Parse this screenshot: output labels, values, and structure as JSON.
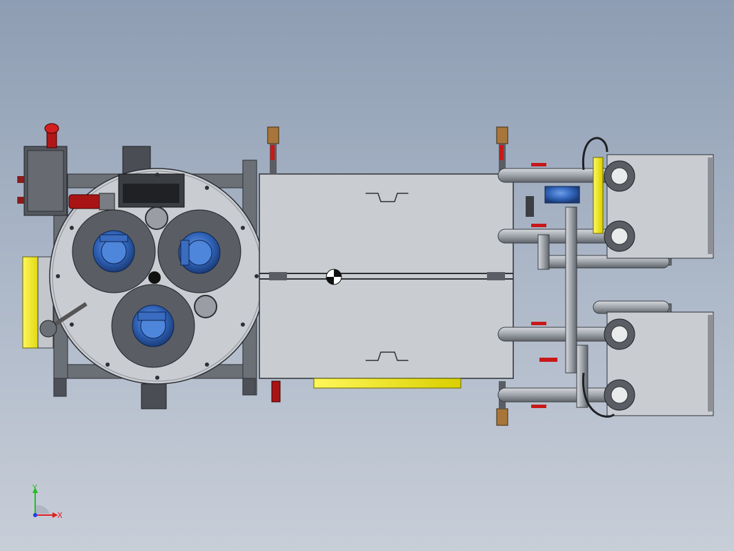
{
  "triad": {
    "x_label": "X",
    "y_label": "Y",
    "x_color": "#e02020",
    "y_color": "#20c020",
    "z_color": "#2040e0"
  },
  "palette": {
    "steel": "#c9ccd1",
    "steel_dark": "#5a5e64",
    "frame": "#6b6f76",
    "pipe": "#9ea3aa",
    "safety_yellow": "#f2ec1a",
    "filter_blue": "#2f63b8",
    "valve_red": "#c81818",
    "brass": "#a8763a"
  },
  "components": [
    "main-frame",
    "rotary-filter-disc",
    "filter-housing",
    "tank-box",
    "pipe-manifold",
    "pump-units",
    "control-box",
    "drain-valves"
  ]
}
